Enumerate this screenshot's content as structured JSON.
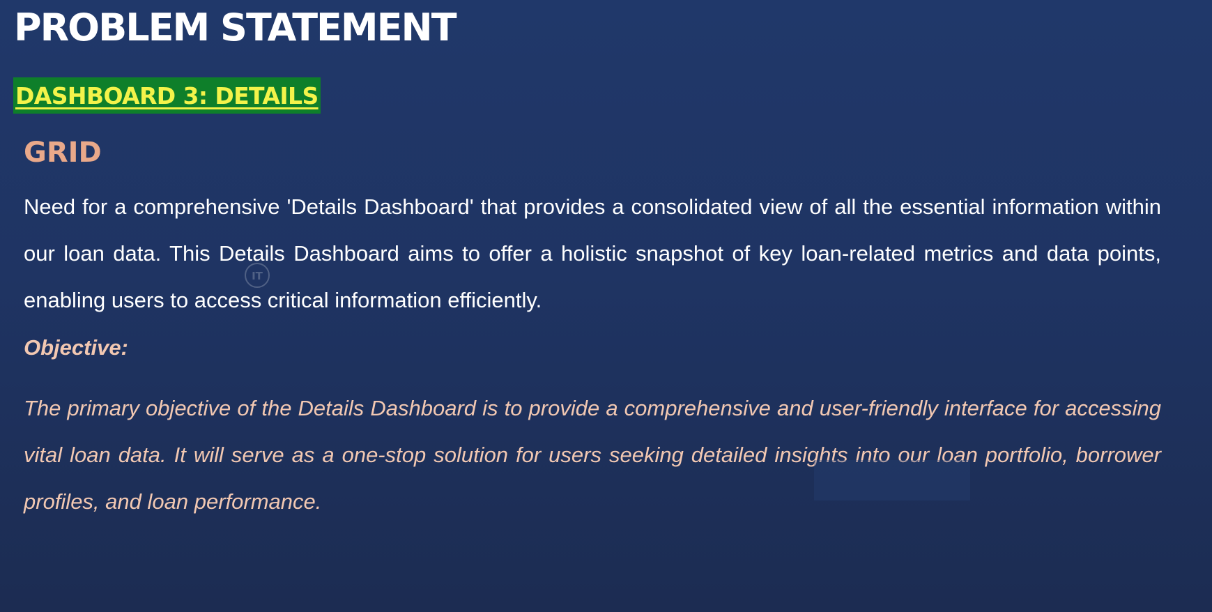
{
  "slide": {
    "title": "PROBLEM STATEMENT",
    "badge": "DASHBOARD 3: DETAILS",
    "section_heading": "GRID",
    "description": "Need for a comprehensive 'Details Dashboard' that provides a consolidated view of all the essential information within our loan data. This Details Dashboard aims to offer a holistic snapshot of key loan-related metrics and data points, enabling users to access critical information efficiently.",
    "objective_label": "Objective:",
    "objective_text": "The primary objective of the Details Dashboard is to provide a comprehensive and user-friendly interface for accessing vital loan data. It will serve as a one-stop solution for users seeking detailed insights into our loan portfolio, borrower profiles, and loan performance.",
    "watermark": "IT"
  },
  "colors": {
    "background": "#1f3463",
    "title": "#ffffff",
    "badge_background": "#0e7f2a",
    "badge_text": "#f3f34a",
    "section_heading": "#e9a98a",
    "body_text": "#ffffff",
    "objective_text": "#f2c8b2"
  }
}
